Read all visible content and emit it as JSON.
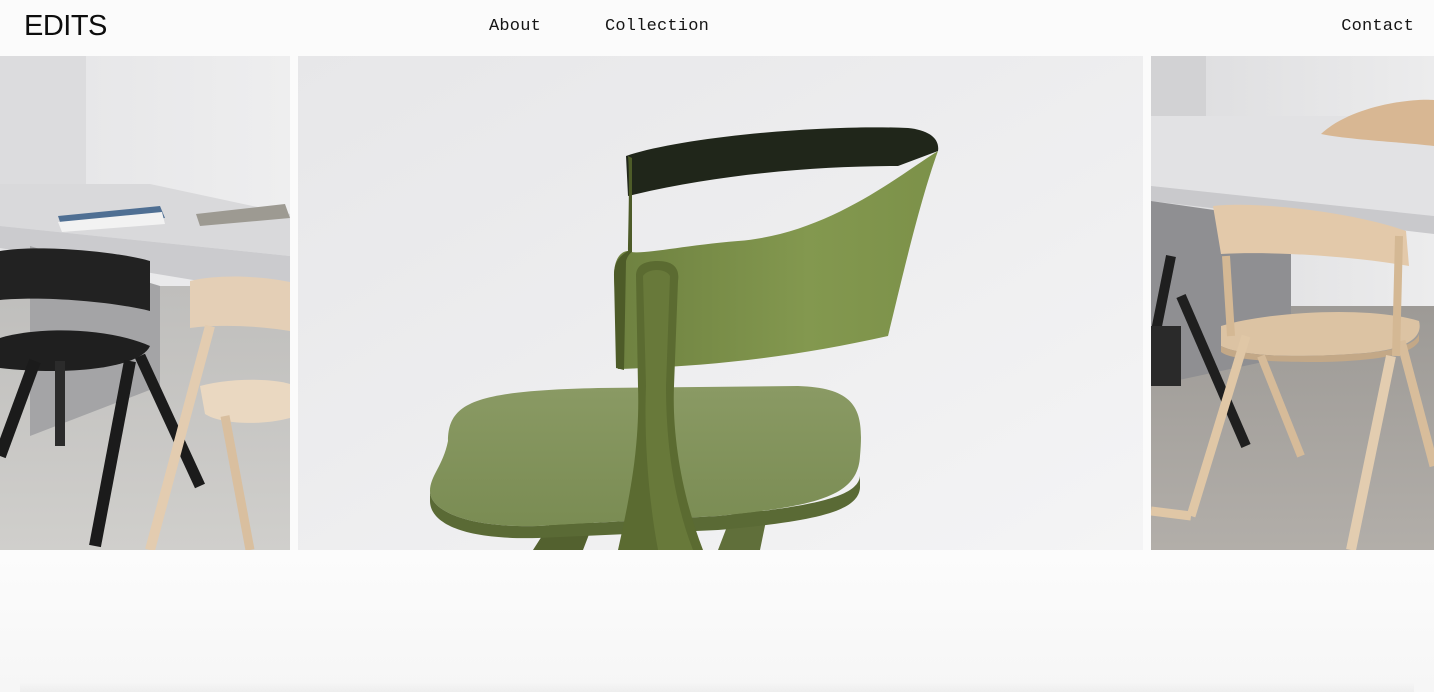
{
  "header": {
    "logo": "EDITS",
    "nav": {
      "about": "About",
      "collection": "Collection",
      "contact": "Contact"
    }
  },
  "gallery": {
    "slides": [
      {
        "subject": "dining table with black and natural oak chairs"
      },
      {
        "subject": "green wooden chair close-up"
      },
      {
        "subject": "natural oak chairs around white table"
      }
    ]
  },
  "colors": {
    "background": "#fbfbfb",
    "text": "#111111",
    "chair_green": "#7b8e4c",
    "chair_natural": "#e6d2b8",
    "chair_black": "#1e1e1e"
  }
}
